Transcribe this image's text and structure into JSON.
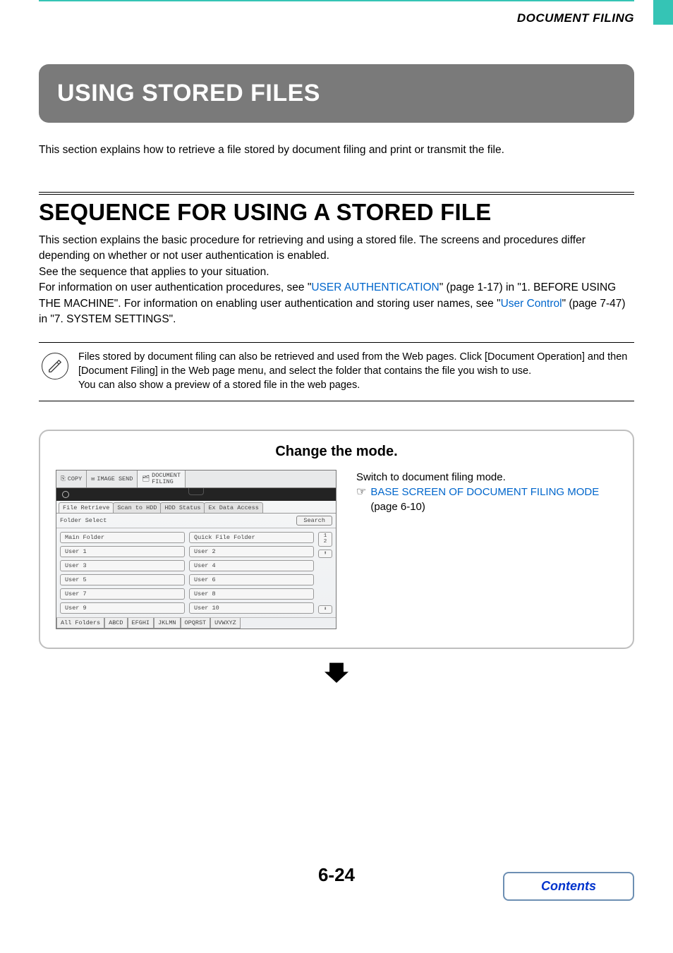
{
  "header": {
    "section": "DOCUMENT FILING"
  },
  "chapter": {
    "title": "USING STORED FILES"
  },
  "intro": "This section explains how to retrieve a file stored by document filing and print or transmit the file.",
  "section": {
    "title": "SEQUENCE FOR USING A STORED FILE",
    "p1": "This section explains the basic procedure for retrieving and using a stored file. The screens and procedures differ depending on whether or not user authentication is enabled.",
    "p2": "See the sequence that applies to your situation.",
    "p3a": "For information on user authentication procedures, see \"",
    "link1": "USER AUTHENTICATION",
    "p3b": "\" (page 1-17) in \"1. BEFORE USING THE MACHINE\". For information on enabling user authentication and storing user names, see \"",
    "link2": "User Control",
    "p3c": "\" (page 7-47) in \"7. SYSTEM SETTINGS\"."
  },
  "note": {
    "l1": "Files stored by document filing can also be retrieved and used from the Web pages. Click [Document Operation] and then [Document Filing] in the Web page menu, and select the folder that contains the file you wish to use.",
    "l2": "You can also show a preview of a stored file in the web pages."
  },
  "step": {
    "title": "Change the mode.",
    "r1": "Switch to document filing mode.",
    "link": "BASE SCREEN OF DOCUMENT FILING MODE",
    "r2": " (page 6-10)"
  },
  "mock": {
    "tabs": {
      "copy": "COPY",
      "send": "IMAGE SEND",
      "df1": "DOCUMENT",
      "df2": "FILING"
    },
    "subtabs": {
      "a": "File Retrieve",
      "b": "Scan to HDD",
      "c": "HDD Status",
      "d": "Ex Data Access"
    },
    "row": {
      "label": "Folder Select",
      "search": "Search"
    },
    "folders": {
      "main": "Main Folder",
      "qf": "Quick File Folder",
      "u1": "User 1",
      "u2": "User 2",
      "u3": "User 3",
      "u4": "User 4",
      "u5": "User 5",
      "u6": "User 6",
      "u7": "User 7",
      "u8": "User 8",
      "u9": "User 9",
      "u10": "User 10"
    },
    "pg1": "1",
    "pg2": "2",
    "up": "⬆",
    "dn": "⬇",
    "alpha": {
      "all": "All Folders",
      "a": "ABCD",
      "b": "EFGHI",
      "c": "JKLMN",
      "d": "OPQRST",
      "e": "UVWXYZ"
    }
  },
  "footer": {
    "page": "6-24",
    "contents": "Contents"
  }
}
